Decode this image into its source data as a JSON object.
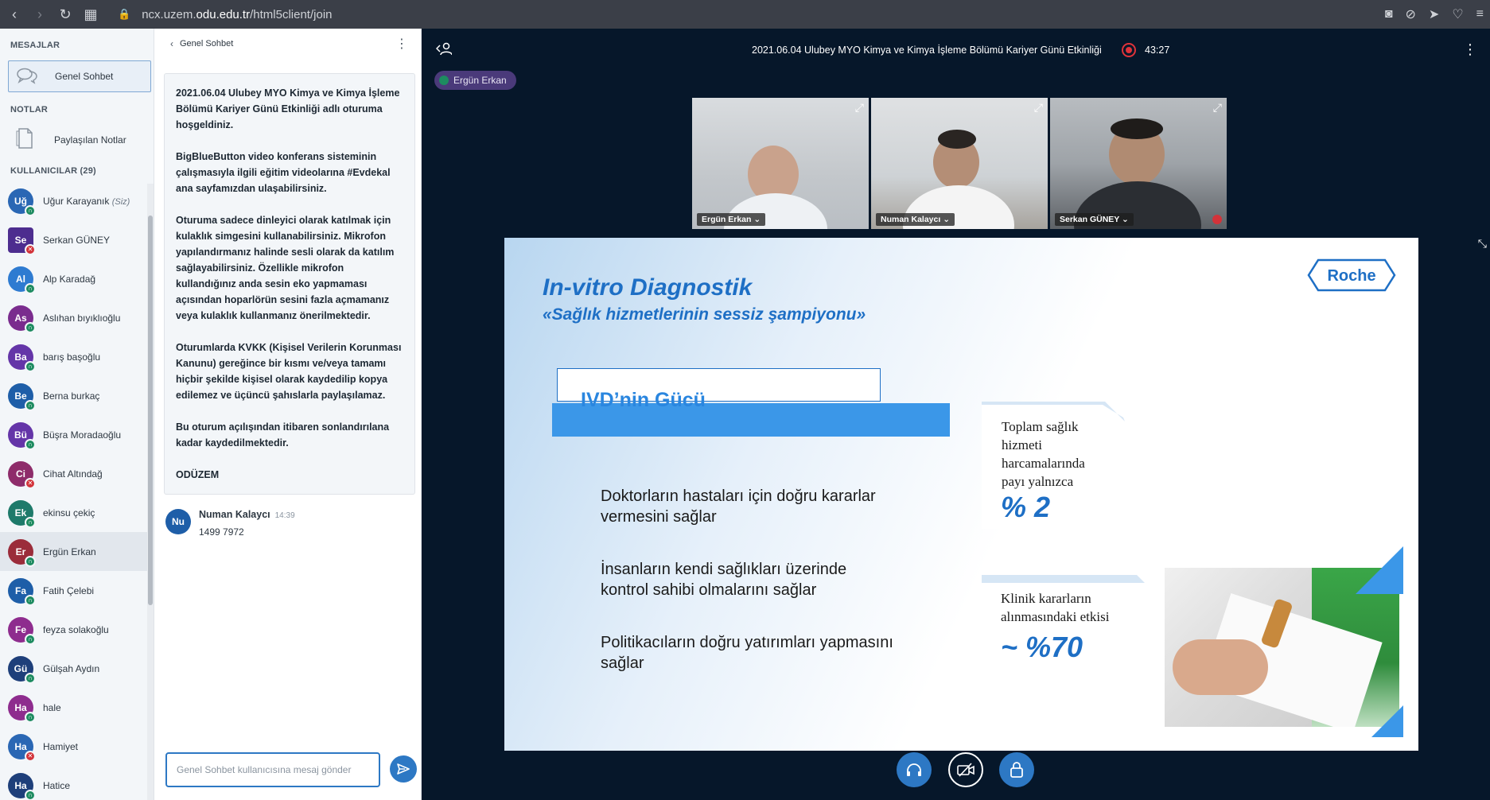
{
  "browser": {
    "url_prefix": "ncx.uzem.",
    "url_host": "odu.edu.tr",
    "url_path": "/html5client/join"
  },
  "sidebar": {
    "messages_title": "MESAJLAR",
    "public_chat_label": "Genel Sohbet",
    "notes_title": "NOTLAR",
    "shared_notes_label": "Paylaşılan Notlar",
    "users_title": "KULLANICILAR (29)",
    "users": [
      {
        "initials": "Uğ",
        "name": "Uğur Karayanık",
        "suffix": "(Siz)",
        "color": "#2a67b4",
        "status": "listen",
        "square": false
      },
      {
        "initials": "Se",
        "name": "Serkan GÜNEY",
        "suffix": "",
        "color": "#4d2d8f",
        "status": "muted",
        "square": true
      },
      {
        "initials": "Al",
        "name": "Alp Karadağ",
        "suffix": "",
        "color": "#2e7bd1",
        "status": "listen",
        "square": false
      },
      {
        "initials": "As",
        "name": "Aslıhan bıyıklıoğlu",
        "suffix": "",
        "color": "#7a2c8e",
        "status": "listen",
        "square": false
      },
      {
        "initials": "Ba",
        "name": "barış başoğlu",
        "suffix": "",
        "color": "#6435a8",
        "status": "listen",
        "square": false
      },
      {
        "initials": "Be",
        "name": "Berna burkaç",
        "suffix": "",
        "color": "#1e5ea8",
        "status": "listen",
        "square": false
      },
      {
        "initials": "Bü",
        "name": "Büşra Moradaoğlu",
        "suffix": "",
        "color": "#6435a8",
        "status": "listen",
        "square": false
      },
      {
        "initials": "Ci",
        "name": "Cihat Altındağ",
        "suffix": "",
        "color": "#8e2c6a",
        "status": "muted",
        "square": false
      },
      {
        "initials": "Ek",
        "name": "ekinsu çekiç",
        "suffix": "",
        "color": "#1e7a6a",
        "status": "listen",
        "square": false
      },
      {
        "initials": "Er",
        "name": "Ergün Erkan",
        "suffix": "",
        "color": "#9b2c3a",
        "status": "listen",
        "square": false
      },
      {
        "initials": "Fa",
        "name": "Fatih Çelebi",
        "suffix": "",
        "color": "#1e5ea8",
        "status": "listen",
        "square": false
      },
      {
        "initials": "Fe",
        "name": "feyza solakoğlu",
        "suffix": "",
        "color": "#8e2c8e",
        "status": "listen",
        "square": false
      },
      {
        "initials": "Gü",
        "name": "Gülşah Aydın",
        "suffix": "",
        "color": "#1e3f7a",
        "status": "listen",
        "square": false
      },
      {
        "initials": "Ha",
        "name": "hale",
        "suffix": "",
        "color": "#8e2c8e",
        "status": "listen",
        "square": false
      },
      {
        "initials": "Ha",
        "name": "Hamiyet",
        "suffix": "",
        "color": "#2a67b4",
        "status": "muted",
        "square": false
      },
      {
        "initials": "Ha",
        "name": "Hatice",
        "suffix": "",
        "color": "#1e3f7a",
        "status": "listen",
        "square": false
      }
    ]
  },
  "chat": {
    "header_title": "Genel Sohbet",
    "welcome": [
      "2021.06.04 Ulubey MYO Kimya ve Kimya İşleme Bölümü Kariyer Günü Etkinliği adlı oturuma hoşgeldiniz.",
      "BigBlueButton video konferans sisteminin çalışmasıyla ilgili eğitim videolarına #Evdekal ana sayfamızdan ulaşabilirsiniz.",
      "Oturuma sadece dinleyici olarak katılmak için kulaklık simgesini kullanabilirsiniz. Mikrofon yapılandırmanız halinde sesli olarak da katılım sağlayabilirsiniz. Özellikle mikrofon kullandığınız anda sesin eko yapmaması açısından hoparlörün sesini fazla açmamanız veya kulaklık kullanmanız önerilmektedir.",
      "Oturumlarda KVKK (Kişisel Verilerin Korunması Kanunu) gereğince bir kısmı ve/veya tamamı hiçbir şekilde kişisel olarak kaydedilip kopya edilemez ve üçüncü şahıslarla paylaşılamaz.",
      "Bu oturum açılışından itibaren sonlandırılana kadar kaydedilmektedir.",
      "ODÜZEM"
    ],
    "message": {
      "initials": "Nu",
      "sender": "Numan Kalaycı",
      "time": "14:39",
      "text": "1499 7972"
    },
    "input_placeholder": "Genel Sohbet kullanıcısına mesaj gönder"
  },
  "main": {
    "meeting_title": "2021.06.04 Ulubey MYO Kimya ve Kimya İşleme Bölümü Kariyer Günü Etkinliği",
    "recording_time": "43:27",
    "talker": "Ergün Erkan",
    "videos": [
      {
        "name": "Ergün Erkan"
      },
      {
        "name": "Numan Kalaycı"
      },
      {
        "name": "Serkan GÜNEY"
      }
    ]
  },
  "slide": {
    "title": "In-vitro Diagnostik",
    "subtitle": "«Sağlık hizmetlerinin sessiz şampiyonu»",
    "logo_text": "Roche",
    "section_title": "IVD’nin Gücü",
    "bullets": [
      {
        "line1": "Doktorların hastaları için doğru kararlar",
        "line2": "vermesini sağlar"
      },
      {
        "line1": "İnsanların kendi sağlıkları üzerinde",
        "line2": "kontrol sahibi olmalarını sağlar"
      },
      {
        "line1": "Politikacıların doğru yatırımları yapmasını",
        "line2": "sağlar"
      }
    ],
    "stat1_lines": [
      "Toplam sağlık",
      "hizmeti",
      "harcamalarında",
      "payı yalnızca"
    ],
    "stat1_value": "% 2",
    "stat2_lines": [
      "Klinik kararların",
      "alınmasındaki etkisi"
    ],
    "stat2_value": "~ %70"
  },
  "colors": {
    "accent": "#2d78c4",
    "slide_blue": "#1e6fc5",
    "listen_status": "#1d8b60",
    "muted_status": "#d3333a",
    "recording": "#e0333a"
  }
}
